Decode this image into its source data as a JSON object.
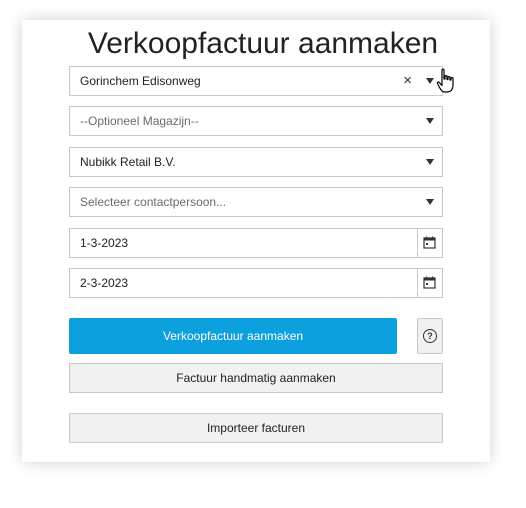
{
  "form": {
    "title": "Verkoopfactuur aanmaken",
    "location_select": {
      "value": "Gorinchem Edisonweg",
      "clear_symbol": "×"
    },
    "warehouse_select": {
      "placeholder": "--Optioneel Magazijn--"
    },
    "customer_select": {
      "value": "Nubikk Retail B.V."
    },
    "contact_select": {
      "placeholder": "Selecteer contactpersoon..."
    },
    "invoice_date": {
      "value": "1-3-2023",
      "icon": "calendar-icon"
    },
    "due_date": {
      "value": "2-3-2023",
      "icon": "calendar-icon"
    },
    "buttons": {
      "create_label": "Verkoopfactuur aanmaken",
      "help_symbol": "?",
      "manual_label": "Factuur handmatig aanmaken",
      "import_label": "Importeer facturen"
    }
  },
  "colors": {
    "primary": "#0ca0df",
    "border": "#c8c8c8",
    "secondary_bg": "#f1f1f1"
  }
}
